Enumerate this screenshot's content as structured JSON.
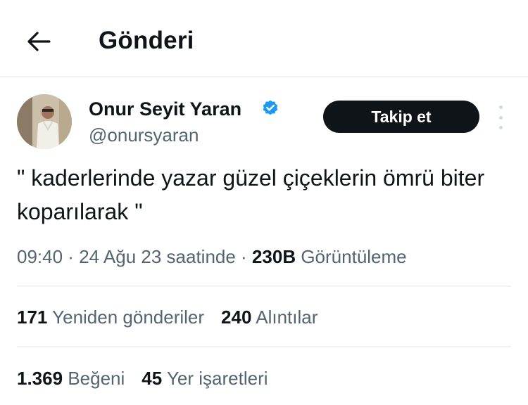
{
  "header": {
    "back_icon": "arrow-left-icon",
    "title": "Gönderi"
  },
  "author": {
    "display_name": "Onur Seyit Yaran",
    "verified_icon": "verified-badge-icon",
    "handle": "@onursyaran",
    "follow_label": "Takip et",
    "more_icon": "more-vertical-icon"
  },
  "tweet": {
    "text": "\" kaderlerinde yazar güzel çiçeklerin ömrü biter koparılarak \"",
    "time": "09:40",
    "date": "24 Ağu 23 saatinde",
    "views_count": "230B",
    "views_label": "Görüntüleme"
  },
  "stats": {
    "reposts_count": "171",
    "reposts_label": "Yeniden gönderiler",
    "quotes_count": "240",
    "quotes_label": "Alıntılar",
    "likes_count": "1.369",
    "likes_label": "Beğeni",
    "bookmarks_count": "45",
    "bookmarks_label": "Yer işaretleri"
  },
  "colors": {
    "text_primary": "#0f1419",
    "text_secondary": "#536471",
    "verified_blue": "#1d9bf0",
    "button_bg": "#0f1419",
    "divider": "#eff3f4"
  }
}
